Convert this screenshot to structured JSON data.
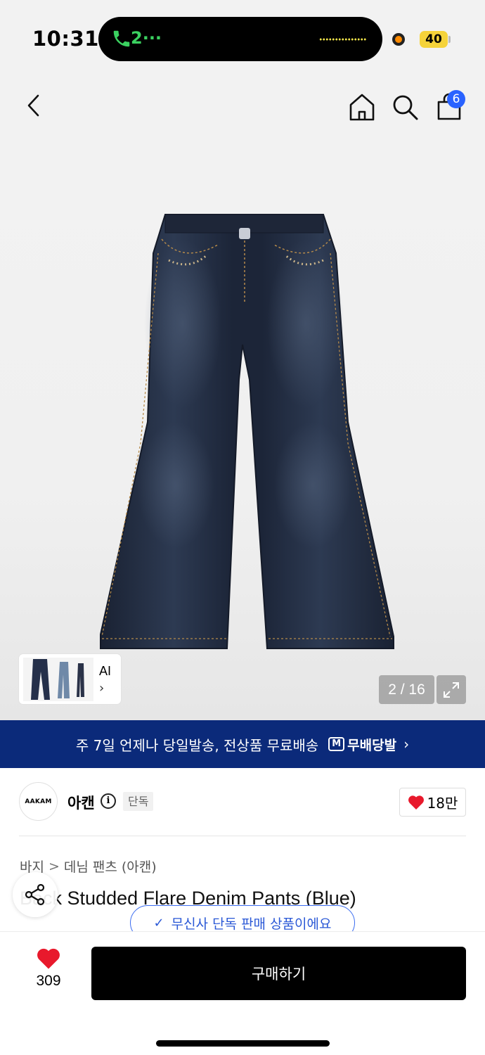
{
  "status_bar": {
    "time": "10:31",
    "call_label": "2···",
    "battery": "40"
  },
  "nav": {
    "cart_count": "6"
  },
  "gallery": {
    "thumbnail_label": "AI",
    "thumbnail_chevron": "›",
    "counter": "2 / 16"
  },
  "banner": {
    "text": "주 7일 언제나 당일발송, 전상품 무료배송",
    "logo_mark": "M",
    "logo_text": "무배당발",
    "chevron": "›"
  },
  "brand": {
    "logo_text": "AAKAM",
    "name": "아캔",
    "info_glyph": "i",
    "badge": "단독",
    "likes": "18만"
  },
  "product": {
    "breadcrumb": [
      "바지",
      "데님 팬츠 (아캔)"
    ],
    "breadcrumb_sep": ">",
    "title": "Back Studded Flare Denim Pants (Blue)",
    "exclusive_toast": "무신사 단독 판매 상품이에요",
    "toast_check": "✓"
  },
  "bottom_bar": {
    "wish_count": "309",
    "buy_label": "구매하기"
  },
  "colors": {
    "banner_bg": "#0b2a7a",
    "accent_blue": "#2a63ff",
    "heart_red": "#e8192c",
    "call_green": "#3bd160",
    "battery_yellow": "#f5d33a"
  },
  "icons": [
    "back-icon",
    "home-icon",
    "search-icon",
    "shopping-bag-icon",
    "expand-icon",
    "delivery-truck-icon",
    "info-icon",
    "heart-icon",
    "share-icon",
    "check-icon",
    "phone-icon"
  ]
}
